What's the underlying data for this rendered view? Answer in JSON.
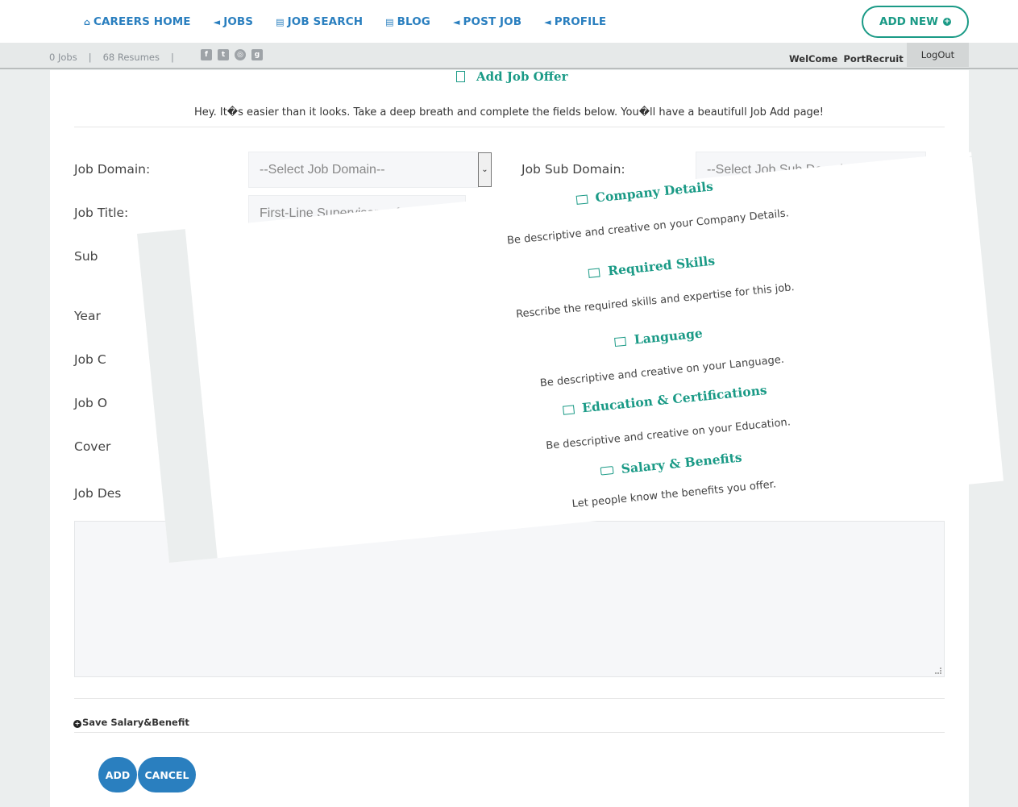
{
  "nav": {
    "items": [
      {
        "label": "CAREERS HOME",
        "icon": "home-icon",
        "glyph": "⌂"
      },
      {
        "label": "JOBS",
        "icon": "bullhorn-icon",
        "glyph": "◄"
      },
      {
        "label": "JOB SEARCH",
        "icon": "document-icon",
        "glyph": "▤"
      },
      {
        "label": "BLOG",
        "icon": "document-icon",
        "glyph": "▤"
      },
      {
        "label": "POST JOB",
        "icon": "bullhorn-icon",
        "glyph": "◄"
      },
      {
        "label": "PROFILE",
        "icon": "bullhorn-icon",
        "glyph": "◄"
      }
    ],
    "add_new_label": "ADD NEW",
    "accent": "#1a9a86",
    "link_color": "#2a7fbf"
  },
  "subbar": {
    "jobs_count": "0 Jobs",
    "separator": "|",
    "resumes_count": "68 Resumes",
    "socials": [
      {
        "icon": "facebook-icon",
        "glyph": "f"
      },
      {
        "icon": "twitter-icon",
        "glyph": "t"
      },
      {
        "icon": "dribbble-icon",
        "glyph": "◎"
      },
      {
        "icon": "google-plus-icon",
        "glyph": "g"
      }
    ],
    "welcome_label": "WelCome",
    "username": "PortRecruit",
    "logout_label": "LogOut"
  },
  "form": {
    "title": "Add Job Offer",
    "intro": "Hey. It�s easier than it looks. Take a deep breath and complete the fields below. You�ll have a beautifull Job Add page!",
    "job_domain_label": "Job Domain:",
    "job_domain_value": "--Select Job Domain--",
    "job_subdomain_label": "Job Sub Domain:",
    "job_subdomain_value": "--Select Job Sub Domain--",
    "job_title_label": "Job Title:",
    "job_title_value": "First-Line Supervisors of Landscaping",
    "partial_labels": [
      "Sub",
      "Year",
      "Job C",
      "Job O",
      "Cover",
      "Job Des"
    ],
    "save_salary_label": "Save Salary&Benefit",
    "add_label": "ADD",
    "cancel_label": "CANCEL"
  },
  "overlay": {
    "sections": [
      {
        "title": "Company Details",
        "icon": "bar-chart-icon",
        "desc": "Be descriptive and creative on your Company Details."
      },
      {
        "title": "Required Skills",
        "icon": "bar-chart-icon",
        "desc": "Rescribe the required skills and expertise for this job."
      },
      {
        "title": "Language",
        "icon": "bar-chart-icon",
        "desc": "Be descriptive and creative on your Language."
      },
      {
        "title": "Education & Certifications",
        "icon": "bar-chart-icon",
        "desc": "Be descriptive and creative on your Education."
      },
      {
        "title": "Salary & Benefits",
        "icon": "money-icon",
        "desc": "Let people know the benefits you offer."
      }
    ]
  }
}
